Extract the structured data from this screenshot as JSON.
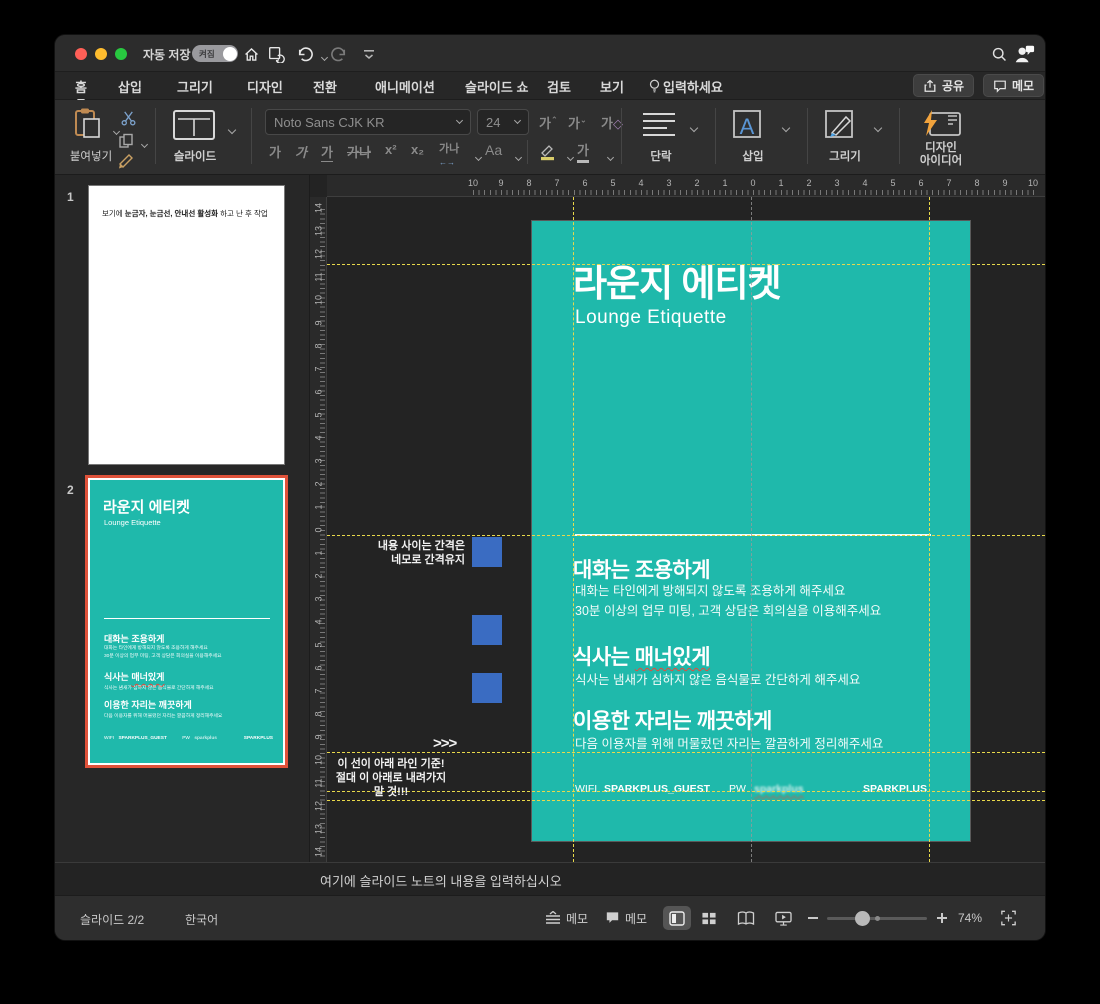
{
  "titlebar": {
    "autosave_label": "자동 저장",
    "autosave_state": "켜짐"
  },
  "tabs": {
    "items": [
      "홈",
      "삽입",
      "그리기",
      "디자인",
      "전환",
      "애니메이션",
      "슬라이드 쇼",
      "검토",
      "보기"
    ],
    "tell_me": "입력하세요",
    "share": "공유",
    "comments": "메모"
  },
  "ribbon": {
    "paste": "붙여넣기",
    "slide": "슬라이드",
    "font_name": "Noto Sans CJK KR",
    "font_size": "24",
    "glyphs": {
      "grow": "가",
      "shrink": "가",
      "clear": "가",
      "bold": "가",
      "italic": "가",
      "underline": "가",
      "strike": "가나",
      "sup": "x²",
      "sub": "x₂",
      "spacing": "가나",
      "case": "Aa",
      "fontcolor": "가"
    },
    "paragraph": "단락",
    "insert": "삽입",
    "draw": "그리기",
    "design_ideas_1": "디자인",
    "design_ideas_2": "아이디어"
  },
  "thumbnails": {
    "slide1": {
      "number": "1",
      "pre": "보기에 ",
      "bold": "눈금자, 눈금선, 안내선 활성화",
      "post": " 하고 난 후 작업"
    },
    "slide2": {
      "number": "2"
    }
  },
  "slide": {
    "title": "라운지 에티켓",
    "subtitle": "Lounge Etiquette",
    "sections": [
      {
        "heading": "대화는 조용하게",
        "heading_parts": [
          "대화는 조용하게",
          ""
        ],
        "body": [
          "대화는 타인에게 방해되지 않도록 조용하게 해주세요",
          "30분 이상의 업무 미팅, 고객 상담은 회의실을 이용해주세요"
        ]
      },
      {
        "heading": "식사는 매너있게",
        "heading_parts": [
          "식사는 ",
          "매너있게"
        ],
        "body": [
          "식사는 냄새가 심하지 않은 음식물로 간단하게 해주세요"
        ]
      },
      {
        "heading": "이용한 자리는 깨끗하게",
        "heading_parts": [
          "이용한 자리는 깨끗하게",
          ""
        ],
        "body": [
          "다음 이용자를 위해 머물렀던 자리는 깔끔하게 정리해주세요"
        ]
      }
    ],
    "footer": {
      "wifi_label": "WIFI",
      "wifi_value": "SPARKPLUS_GUEST",
      "pw_label": "PW",
      "pw_value": "sparkplus",
      "brand": "SPARKPLUS"
    }
  },
  "annotations": {
    "spacing": [
      "내용 사이는 간격은",
      "네모로 간격유지"
    ],
    "arrows": ">>>",
    "baseline": [
      "이 선이 아래 라인 기준!",
      "절대 이 아래로 내려가지  말 것!!!"
    ]
  },
  "rulers": {
    "horizontal": [
      10,
      9,
      8,
      7,
      6,
      5,
      4,
      3,
      2,
      1,
      0,
      1,
      2,
      3,
      4,
      5,
      6,
      7,
      8,
      9,
      10
    ],
    "vertical": [
      14,
      13,
      12,
      11,
      10,
      9,
      8,
      7,
      6,
      5,
      4,
      3,
      2,
      1,
      0,
      1,
      2,
      3,
      4,
      5,
      6,
      7,
      8,
      9,
      10,
      11,
      12,
      13,
      14
    ]
  },
  "notes": {
    "placeholder": "여기에 슬라이드 노트의 내용을 입력하십시오"
  },
  "statusbar": {
    "slide_indicator": "슬라이드 2/2",
    "language": "한국어",
    "notes_label": "메모",
    "comments_label": "메모",
    "zoom_level": "74%"
  },
  "colors": {
    "teal": "#1fb9ab",
    "selection": "#e0523a",
    "guide_yellow": "#e8d84a",
    "guide_gray": "#9a9a9a",
    "square_blue": "#3a6cc2"
  }
}
